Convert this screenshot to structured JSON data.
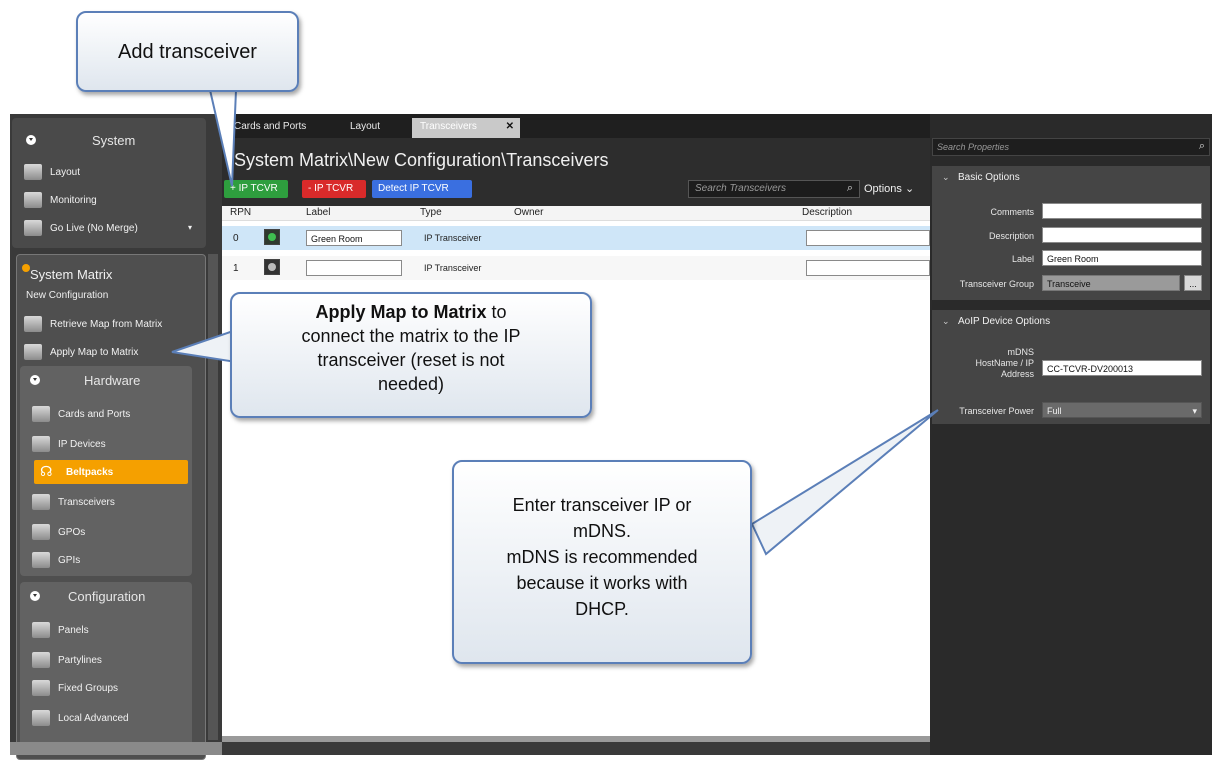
{
  "colors": {
    "accent_orange": "#f5a000",
    "green": "#2e9e3e",
    "red": "#d92a2a",
    "blue": "#3a6fe0",
    "selected_row": "#cfe6f8"
  },
  "sidebar": {
    "system": {
      "title": "System",
      "items": [
        {
          "label": "Layout",
          "icon": "layout-icon"
        },
        {
          "label": "Monitoring",
          "icon": "monitoring-icon"
        },
        {
          "label": "Go Live (No Merge)",
          "icon": "go-live-icon"
        }
      ]
    },
    "system_matrix": {
      "title": "System Matrix",
      "subtitle": "New Configuration",
      "items": [
        {
          "label": "Retrieve Map from Matrix",
          "icon": "retrieve-icon"
        },
        {
          "label": "Apply Map to Matrix",
          "icon": "apply-icon"
        }
      ]
    },
    "hardware": {
      "title": "Hardware",
      "items": [
        {
          "label": "Cards and Ports",
          "icon": "cards-icon"
        },
        {
          "label": "IP Devices",
          "icon": "ip-devices-icon"
        },
        {
          "label": "Beltpacks",
          "icon": "headset-icon"
        },
        {
          "label": "Transceivers",
          "icon": "transceiver-icon"
        },
        {
          "label": "GPOs",
          "icon": "gpo-icon"
        },
        {
          "label": "GPIs",
          "icon": "gpi-icon"
        }
      ]
    },
    "configuration": {
      "title": "Configuration",
      "items": [
        {
          "label": "Panels",
          "icon": "panels-icon"
        },
        {
          "label": "Partylines",
          "icon": "partylines-icon"
        },
        {
          "label": "Fixed Groups",
          "icon": "fixed-groups-icon"
        },
        {
          "label": "Local Advanced",
          "icon": "local-advanced-icon"
        }
      ]
    }
  },
  "tabs": [
    {
      "label": "Cards and Ports"
    },
    {
      "label": "Layout"
    },
    {
      "label": "Transceivers",
      "close": "✕"
    }
  ],
  "main": {
    "breadcrumb": "System Matrix\\New Configuration\\Transceivers",
    "toolbar": {
      "add": "+ IP TCVR",
      "remove": "- IP TCVR",
      "detect": "Detect IP TCVR",
      "search_placeholder": "Search Transceivers",
      "options": "Options"
    },
    "columns": [
      "RPN",
      "Label",
      "Type",
      "Owner",
      "Description"
    ],
    "rows": [
      {
        "rpn": "0",
        "label": "Green Room",
        "type": "IP Transceiver",
        "owner": "",
        "description": ""
      },
      {
        "rpn": "1",
        "label": "",
        "type": "IP Transceiver",
        "owner": "",
        "description": ""
      }
    ]
  },
  "properties": {
    "search_placeholder": "Search Properties",
    "basic": {
      "title": "Basic Options",
      "comments_label": "Comments",
      "comments": "",
      "description_label": "Description",
      "description": "",
      "label_label": "Label",
      "label": "Green Room",
      "group_label": "Transceiver Group",
      "group": "Transceive",
      "group_button": "..."
    },
    "aoip": {
      "title": "AoIP Device Options",
      "mdns_label_1": "mDNS",
      "mdns_label_2": "HostName / IP",
      "mdns_label_3": "Address",
      "mdns": "CC-TCVR-DV200013",
      "power_label": "Transceiver Power",
      "power": "Full"
    }
  },
  "callouts": {
    "add": "Add transceiver",
    "apply_bold": "Apply Map to Matrix",
    "apply_rest_1": " to",
    "apply_rest_2": "connect the matrix to the IP",
    "apply_rest_3": "transceiver (reset is not",
    "apply_rest_4": "needed)",
    "enter_1": "Enter transceiver IP or",
    "enter_2": "mDNS.",
    "enter_3": "mDNS is recommended",
    "enter_4": "because it works with",
    "enter_5": "DHCP."
  }
}
